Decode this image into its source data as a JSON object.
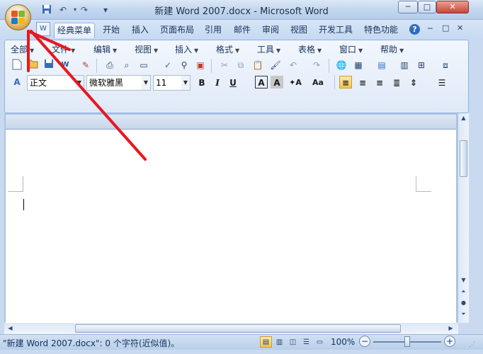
{
  "window": {
    "title": "新建 Word 2007.docx - Microsoft Word",
    "controls": {
      "minimize": "─",
      "maximize": "□",
      "close": "✕"
    }
  },
  "quick_access": {
    "save_icon": "save-icon",
    "undo_icon": "undo-icon",
    "redo_icon": "redo-icon",
    "customize": "▾"
  },
  "ribbon_tabs": [
    {
      "label": "经典菜单",
      "active": true
    },
    {
      "label": "开始"
    },
    {
      "label": "插入"
    },
    {
      "label": "页面布局"
    },
    {
      "label": "引用"
    },
    {
      "label": "邮件"
    },
    {
      "label": "审阅"
    },
    {
      "label": "视图"
    },
    {
      "label": "开发工具"
    },
    {
      "label": "特色功能"
    }
  ],
  "ribbon_controls": {
    "help": "?",
    "minimize": "─",
    "restore": "□",
    "close": "✕"
  },
  "classic_menu": [
    {
      "label": "全部"
    },
    {
      "label": "文件"
    },
    {
      "label": "编辑"
    },
    {
      "label": "视图"
    },
    {
      "label": "插入"
    },
    {
      "label": "格式"
    },
    {
      "label": "工具"
    },
    {
      "label": "表格"
    },
    {
      "label": "窗口"
    },
    {
      "label": "帮助"
    }
  ],
  "format_toolbar": {
    "style": "正文",
    "font": "微软雅黑",
    "size": "11",
    "bold": "B",
    "italic": "I",
    "underline": "U",
    "char_border": "A",
    "char_shading": "A",
    "font_case": "Aa"
  },
  "status": {
    "text": "\"新建 Word 2007.docx\": 0 个字符(近似值)。",
    "zoom": "100%",
    "zoom_out": "−",
    "zoom_in": "+",
    "zoom_level_fraction": 0.5
  },
  "colors": {
    "accent": "#2b579a",
    "annotation": "#e8171f"
  }
}
